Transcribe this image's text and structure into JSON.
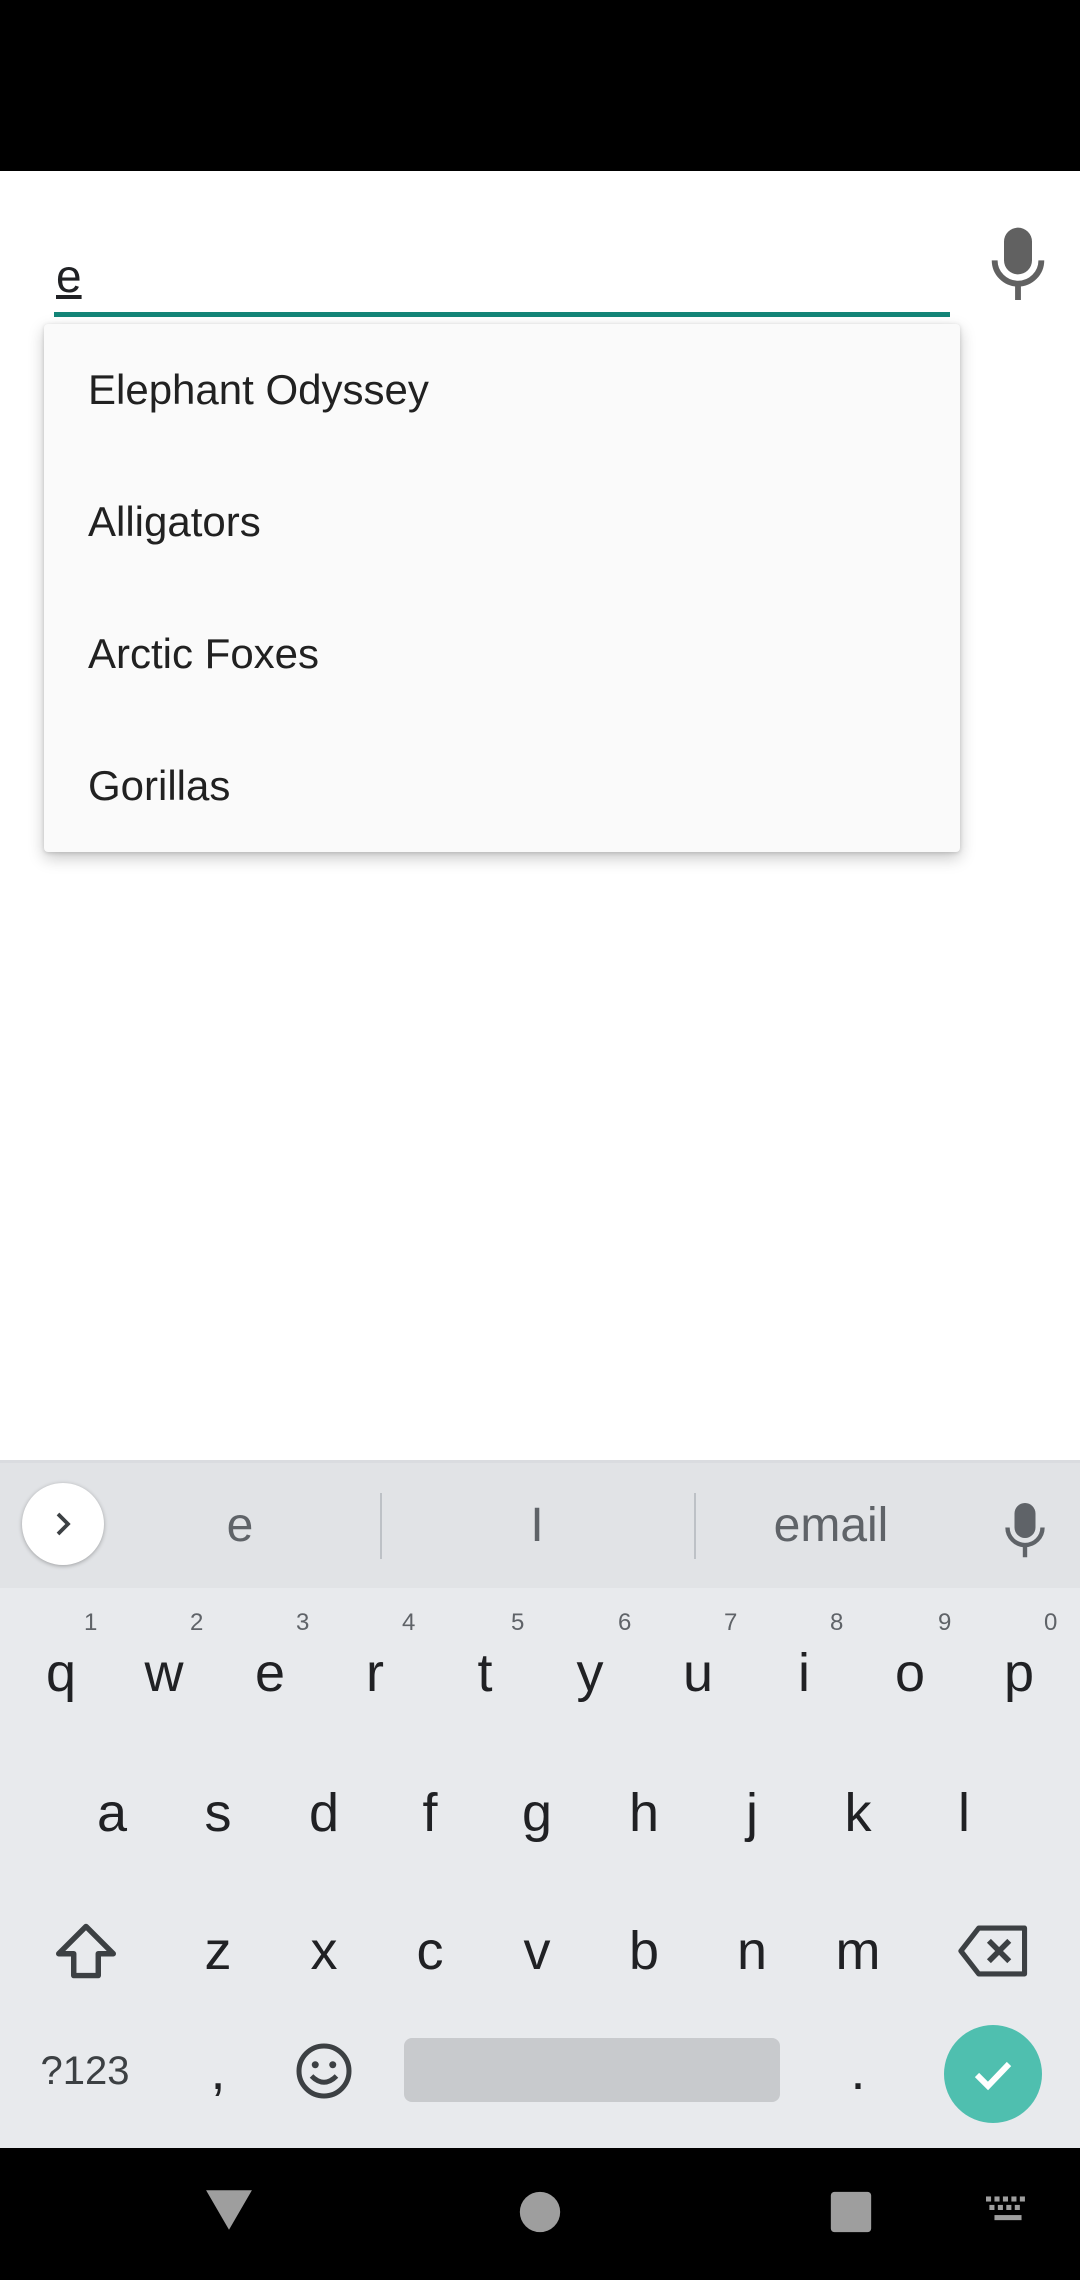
{
  "search": {
    "value": "e"
  },
  "dropdown": {
    "items": [
      {
        "label": "Elephant Odyssey"
      },
      {
        "label": "Alligators"
      },
      {
        "label": "Arctic Foxes"
      },
      {
        "label": "Gorillas"
      }
    ]
  },
  "keyboard": {
    "suggestions": [
      "e",
      "I",
      "email"
    ],
    "row1": [
      {
        "key": "q",
        "hint": "1"
      },
      {
        "key": "w",
        "hint": "2"
      },
      {
        "key": "e",
        "hint": "3"
      },
      {
        "key": "r",
        "hint": "4"
      },
      {
        "key": "t",
        "hint": "5"
      },
      {
        "key": "y",
        "hint": "6"
      },
      {
        "key": "u",
        "hint": "7"
      },
      {
        "key": "i",
        "hint": "8"
      },
      {
        "key": "o",
        "hint": "9"
      },
      {
        "key": "p",
        "hint": "0"
      }
    ],
    "row2": [
      "a",
      "s",
      "d",
      "f",
      "g",
      "h",
      "j",
      "k",
      "l"
    ],
    "row3": [
      "z",
      "x",
      "c",
      "v",
      "b",
      "n",
      "m"
    ],
    "symbols_label": "?123",
    "comma": ",",
    "period": "."
  },
  "colors": {
    "accent": "#138477",
    "enter": "#4fbfaf"
  }
}
